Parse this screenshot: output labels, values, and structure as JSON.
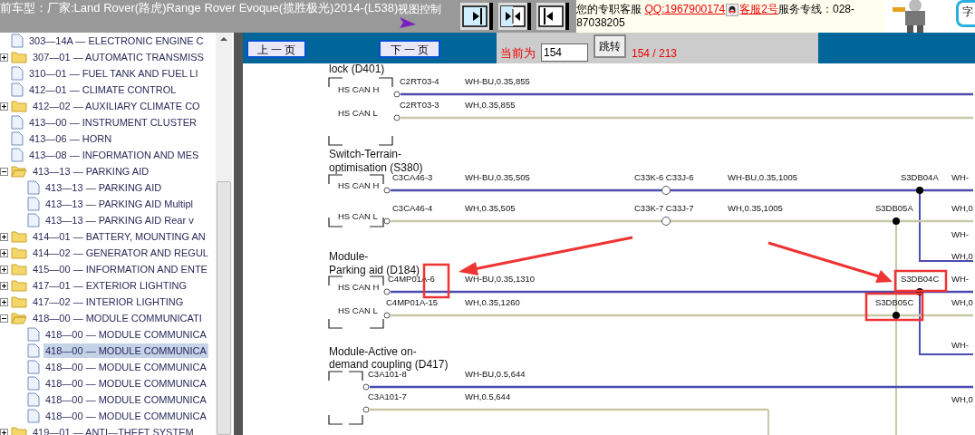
{
  "header": {
    "title": "前车型：厂家:Land Rover(路虎)Range Rover Evoque(揽胜极光)2014-(L538)",
    "view_control": "视图控制",
    "service_label": "您的专职客服",
    "qq_link": "QQ:1967900174",
    "service_link": "客服2号",
    "hotline": "服务专线：028-87038205",
    "corner_text": "字"
  },
  "tree": [
    {
      "kind": "doc",
      "label": "303—14A — ELECTRONIC ENGINE C",
      "selected": false
    },
    {
      "kind": "folder",
      "label": "307—01 — AUTOMATIC TRANSMISS",
      "expanded": false
    },
    {
      "kind": "doc",
      "label": "310—01 — FUEL TANK AND FUEL LI",
      "selected": false
    },
    {
      "kind": "doc",
      "label": "412—01 — CLIMATE CONTROL",
      "selected": false
    },
    {
      "kind": "folder",
      "label": "412—02 — AUXILIARY CLIMATE CO",
      "expanded": false
    },
    {
      "kind": "doc",
      "label": "413—00 — INSTRUMENT CLUSTER",
      "selected": false
    },
    {
      "kind": "doc",
      "label": "413—06 — HORN",
      "selected": false
    },
    {
      "kind": "doc",
      "label": "413—08 — INFORMATION AND MES",
      "selected": false
    },
    {
      "kind": "folder",
      "label": "413—13 — PARKING AID",
      "expanded": true,
      "children": [
        {
          "kind": "doc",
          "label": "413—13 — PARKING AID",
          "selected": false
        },
        {
          "kind": "doc",
          "label": "413—13 — PARKING AID Multipl",
          "selected": false
        },
        {
          "kind": "doc",
          "label": "413—13 — PARKING AID Rear v",
          "selected": false
        }
      ]
    },
    {
      "kind": "folder",
      "label": "414—01 — BATTERY, MOUNTING AN",
      "expanded": false
    },
    {
      "kind": "folder",
      "label": "414—02 — GENERATOR AND REGUL",
      "expanded": false
    },
    {
      "kind": "folder",
      "label": "415—00 — INFORMATION AND ENTE",
      "expanded": false
    },
    {
      "kind": "folder",
      "label": "417—01 — EXTERIOR LIGHTING",
      "expanded": false
    },
    {
      "kind": "folder",
      "label": "417—02 — INTERIOR LIGHTING",
      "expanded": false
    },
    {
      "kind": "folder",
      "label": "418—00 — MODULE COMMUNICATI",
      "expanded": true,
      "children": [
        {
          "kind": "doc",
          "label": "418—00 — MODULE COMMUNICA",
          "selected": false
        },
        {
          "kind": "doc",
          "label": "418—00 — MODULE COMMUNICA",
          "selected": true
        },
        {
          "kind": "doc",
          "label": "418—00 — MODULE COMMUNICA",
          "selected": false
        },
        {
          "kind": "doc",
          "label": "418—00 — MODULE COMMUNICA",
          "selected": false
        },
        {
          "kind": "doc",
          "label": "418—00 — MODULE COMMUNICA",
          "selected": false
        },
        {
          "kind": "doc",
          "label": "418—00 — MODULE COMMUNICA",
          "selected": false
        }
      ]
    },
    {
      "kind": "folder",
      "label": "419—01 — ANTI—THEFT SYSTEM",
      "expanded": false
    }
  ],
  "pager": {
    "prev": "上 一 页",
    "next": "下 一 页",
    "current_label": "当前为",
    "page_input": "154",
    "go_button": "跳转",
    "page_count": "154 / 213"
  },
  "diagram": {
    "modules": [
      {
        "title": [
          "lock (D401)"
        ],
        "pins": [
          {
            "label": "HS CAN H",
            "kind": "bu",
            "connector": "C2RT03-4",
            "wire": "WH-BU,0.35,855"
          },
          {
            "label": "HS CAN L",
            "kind": "wh",
            "connector": "C2RT03-3",
            "wire": "WH,0.35,855"
          }
        ]
      },
      {
        "title": [
          "Switch-Terrain-",
          "optimisation (S380)"
        ],
        "pins": [
          {
            "label": "HS CAN H",
            "kind": "bu",
            "connector": "C3CA46-3",
            "wire": "WH-BU,0.35,505",
            "inline": "C33K-6 C33J-6",
            "wire_2": "WH-BU,0.35,1005",
            "splice": "S3DB04A",
            "end": "WH-"
          },
          {
            "label": "HS CAN L",
            "kind": "wh",
            "connector": "C3CA46-4",
            "wire": "WH,0.35,505",
            "inline": "C33K-7 C33J-7",
            "wire_2": "WH,0.35,1005",
            "splice": "S3DB05A",
            "end": "WH,0"
          }
        ]
      },
      {
        "title": [
          "Module-",
          "Parking aid (D184)"
        ],
        "pins": [
          {
            "label": "HS CAN H",
            "kind": "bu",
            "connector": "C4MP01A-6",
            "wire": "WH-BU,0.35,1310",
            "splice": "S3DB04C",
            "end": "WH-"
          },
          {
            "label": "HS CAN L",
            "kind": "wh",
            "connector": "C4MP01A-15",
            "wire": "WH,0.35,1260",
            "splice": "S3DB05C",
            "end": "WH,0"
          }
        ]
      },
      {
        "title": [
          "Module-Active on-",
          "demand coupling (D417)"
        ],
        "pins": [
          {
            "kind": "bu",
            "connector": "C3A101-8",
            "wire": "WH-BU,0.5,644"
          },
          {
            "kind": "wh",
            "connector": "C3A101-7",
            "wire": "WH,0.5,644"
          }
        ]
      }
    ],
    "side_labels": [
      "WH-",
      "WH,0",
      "WH-",
      "WH,0"
    ]
  }
}
